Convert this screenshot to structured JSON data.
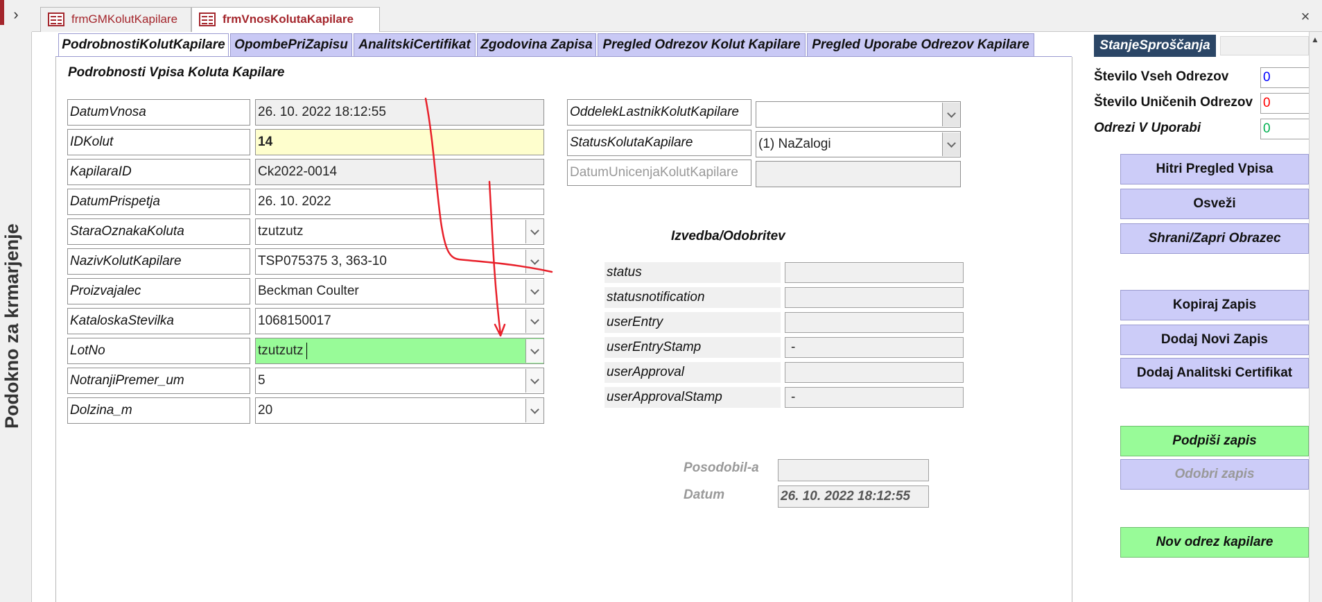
{
  "nav": {
    "title": "Podokno za krmarjenje"
  },
  "doc_tabs": [
    {
      "label": "frmGMKolutKapilare"
    },
    {
      "label": "frmVnosKolutaKapilare"
    }
  ],
  "form_tabs": [
    {
      "label": "PodrobnostiKolutKapilare"
    },
    {
      "label": "OpombePriZapisu"
    },
    {
      "label": "AnalitskiCertifikat"
    },
    {
      "label": "Zgodovina Zapisa"
    },
    {
      "label": "Pregled Odrezov Kolut Kapilare"
    },
    {
      "label": "Pregled Uporabe Odrezov Kapilare"
    }
  ],
  "details": {
    "title": "Podrobnosti Vpisa Koluta Kapilare",
    "fields": [
      {
        "label": "DatumVnosa",
        "value": "26. 10. 2022 18:12:55"
      },
      {
        "label": "IDKolut",
        "value": "14"
      },
      {
        "label": "KapilaraID",
        "value": "Ck2022-0014"
      },
      {
        "label": "DatumPrispetja",
        "value": "26. 10. 2022"
      },
      {
        "label": "StaraOznakaKoluta",
        "value": "tzutzutz"
      },
      {
        "label": "NazivKolutKapilare",
        "value": "TSP075375 3, 363-10"
      },
      {
        "label": "Proizvajalec",
        "value": "Beckman Coulter"
      },
      {
        "label": "KataloskaStevilka",
        "value": "1068150017"
      },
      {
        "label": "LotNo",
        "value": "tzutzutz"
      },
      {
        "label": "NotranjiPremer_um",
        "value": "5"
      },
      {
        "label": "Dolzina_m",
        "value": "20"
      }
    ]
  },
  "middle": {
    "fields": [
      {
        "label": "OddelekLastnikKolutKapilare",
        "value": ""
      },
      {
        "label": "StatusKolutaKapilare",
        "value": "(1) NaZalogi"
      },
      {
        "label": "DatumUnicenjaKolutKapilare",
        "value": ""
      }
    ],
    "izvedba_title": "Izvedba/Odobritev",
    "status_fields": [
      {
        "label": "status",
        "value": ""
      },
      {
        "label": "statusnotification",
        "value": ""
      },
      {
        "label": "userEntry",
        "value": ""
      },
      {
        "label": "userEntryStamp",
        "value": "-"
      },
      {
        "label": "userApproval",
        "value": ""
      },
      {
        "label": "userApprovalStamp",
        "value": "-"
      }
    ],
    "posodobil_label": "Posodobil-a",
    "posodobil_value": "",
    "datum_label": "Datum",
    "datum_value": "26. 10. 2022 18:12:55"
  },
  "right": {
    "stanje_label": "StanjeSproščanja",
    "counts": [
      {
        "label": "Število Vseh Odrezov",
        "value": "0",
        "color": "#0000ff",
        "italic": false
      },
      {
        "label": "Število Uničenih Odrezov",
        "value": "0",
        "color": "#ff0000",
        "italic": false
      },
      {
        "label": "Odrezi V Uporabi",
        "value": "0",
        "color": "#00b050",
        "italic": true
      }
    ],
    "buttons": {
      "hitri": "Hitri Pregled Vpisa",
      "osvezi": "Osveži",
      "shrani": "Shrani/Zapri Obrazec",
      "kopiraj": "Kopiraj Zapis",
      "dodaj_novi": "Dodaj Novi Zapis",
      "dodaj_cert": "Dodaj Analitski Certifikat",
      "podpisi": "Podpiši zapis",
      "odobri": "Odobri zapis",
      "nov_odrez": "Nov odrez kapilare"
    }
  },
  "colors": {
    "accent": "#a4262c",
    "tab": "#c9c9f5",
    "button": "#ccccf8",
    "green": "#98fb98",
    "stanje": "#2b4666",
    "annotation": "#e8202a"
  }
}
